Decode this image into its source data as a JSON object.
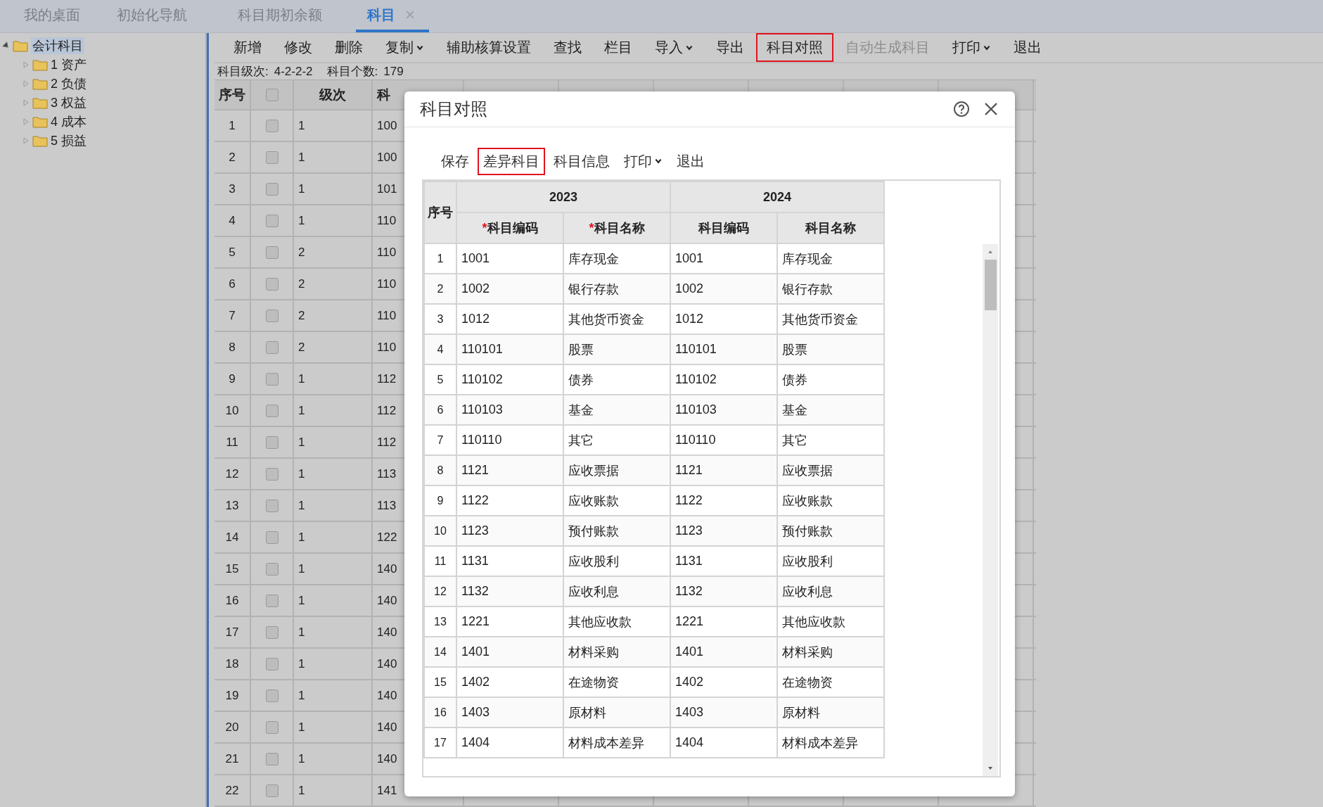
{
  "tabs": [
    {
      "label": "我的桌面",
      "selected": false
    },
    {
      "label": "初始化导航",
      "selected": false
    },
    {
      "label": "科目期初余额",
      "selected": false
    },
    {
      "label": "科目",
      "selected": true,
      "close": "×"
    }
  ],
  "tree": {
    "label": "会计科目",
    "expanded": true,
    "selected": true,
    "children": [
      {
        "label": "1 资产",
        "expanded": false
      },
      {
        "label": "2 负债",
        "expanded": false
      },
      {
        "label": "3 权益",
        "expanded": false
      },
      {
        "label": "4 成本",
        "expanded": false
      },
      {
        "label": "5 损益",
        "expanded": false
      }
    ]
  },
  "toolbar": [
    {
      "label": "新增",
      "dropdown": false,
      "disabled": false,
      "highlighted": false
    },
    {
      "label": "修改",
      "dropdown": false,
      "disabled": false,
      "highlighted": false
    },
    {
      "label": "删除",
      "dropdown": false,
      "disabled": false,
      "highlighted": false
    },
    {
      "label": "复制",
      "dropdown": true,
      "disabled": false,
      "highlighted": false
    },
    {
      "label": "辅助核算设置",
      "dropdown": false,
      "disabled": false,
      "highlighted": false
    },
    {
      "label": "查找",
      "dropdown": false,
      "disabled": false,
      "highlighted": false
    },
    {
      "label": "栏目",
      "dropdown": false,
      "disabled": false,
      "highlighted": false
    },
    {
      "label": "导入",
      "dropdown": true,
      "disabled": false,
      "highlighted": false
    },
    {
      "label": "导出",
      "dropdown": false,
      "disabled": false,
      "highlighted": false
    },
    {
      "label": "科目对照",
      "dropdown": false,
      "disabled": false,
      "highlighted": true
    },
    {
      "label": "自动生成科目",
      "dropdown": false,
      "disabled": true,
      "highlighted": false
    },
    {
      "label": "打印",
      "dropdown": true,
      "disabled": false,
      "highlighted": false
    },
    {
      "label": "退出",
      "dropdown": false,
      "disabled": false,
      "highlighted": false
    }
  ],
  "info": [
    {
      "label": "科目级次:",
      "value": "4-2-2-2"
    },
    {
      "label": "科目个数:",
      "value": "179"
    }
  ],
  "grid": {
    "columns": [
      "序号",
      "级次",
      "科"
    ],
    "header_checked": false,
    "rows": [
      {
        "no": "1",
        "checked": false,
        "level": "1",
        "code": "100"
      },
      {
        "no": "2",
        "checked": false,
        "level": "1",
        "code": "100"
      },
      {
        "no": "3",
        "checked": false,
        "level": "1",
        "code": "101"
      },
      {
        "no": "4",
        "checked": false,
        "level": "1",
        "code": "110"
      },
      {
        "no": "5",
        "checked": false,
        "level": "2",
        "code": "110"
      },
      {
        "no": "6",
        "checked": false,
        "level": "2",
        "code": "110"
      },
      {
        "no": "7",
        "checked": false,
        "level": "2",
        "code": "110"
      },
      {
        "no": "8",
        "checked": false,
        "level": "2",
        "code": "110"
      },
      {
        "no": "9",
        "checked": false,
        "level": "1",
        "code": "112"
      },
      {
        "no": "10",
        "checked": false,
        "level": "1",
        "code": "112"
      },
      {
        "no": "11",
        "checked": false,
        "level": "1",
        "code": "112"
      },
      {
        "no": "12",
        "checked": false,
        "level": "1",
        "code": "113"
      },
      {
        "no": "13",
        "checked": false,
        "level": "1",
        "code": "113"
      },
      {
        "no": "14",
        "checked": false,
        "level": "1",
        "code": "122"
      },
      {
        "no": "15",
        "checked": false,
        "level": "1",
        "code": "140"
      },
      {
        "no": "16",
        "checked": false,
        "level": "1",
        "code": "140"
      },
      {
        "no": "17",
        "checked": false,
        "level": "1",
        "code": "140"
      },
      {
        "no": "18",
        "checked": false,
        "level": "1",
        "code": "140"
      },
      {
        "no": "19",
        "checked": false,
        "level": "1",
        "code": "140"
      },
      {
        "no": "20",
        "checked": false,
        "level": "1",
        "code": "140"
      },
      {
        "no": "21",
        "checked": false,
        "level": "1",
        "code": "140"
      },
      {
        "no": "22",
        "checked": false,
        "level": "1",
        "code": "141"
      }
    ]
  },
  "dialog": {
    "title": "科目对照",
    "toolbar": [
      {
        "label": "保存",
        "dropdown": false,
        "highlighted": false
      },
      {
        "label": "差异科目",
        "dropdown": false,
        "highlighted": true
      },
      {
        "label": "科目信息",
        "dropdown": false,
        "highlighted": false
      },
      {
        "label": "打印",
        "dropdown": true,
        "highlighted": false
      },
      {
        "label": "退出",
        "dropdown": false,
        "highlighted": false
      }
    ],
    "table": {
      "groups": [
        "2023",
        "2024"
      ],
      "columns": [
        {
          "label": "序号"
        },
        {
          "label": "科目编码",
          "mark": "*"
        },
        {
          "label": "科目名称",
          "mark": "*"
        },
        {
          "label": "科目编码"
        },
        {
          "label": "科目名称"
        }
      ],
      "rows": [
        [
          "1",
          "1001",
          "库存现金",
          "1001",
          "库存现金"
        ],
        [
          "2",
          "1002",
          "银行存款",
          "1002",
          "银行存款"
        ],
        [
          "3",
          "1012",
          "其他货币资金",
          "1012",
          "其他货币资金"
        ],
        [
          "4",
          "110101",
          "股票",
          "110101",
          "股票"
        ],
        [
          "5",
          "110102",
          "债券",
          "110102",
          "债券"
        ],
        [
          "6",
          "110103",
          "基金",
          "110103",
          "基金"
        ],
        [
          "7",
          "110110",
          "其它",
          "110110",
          "其它"
        ],
        [
          "8",
          "1121",
          "应收票据",
          "1121",
          "应收票据"
        ],
        [
          "9",
          "1122",
          "应收账款",
          "1122",
          "应收账款"
        ],
        [
          "10",
          "1123",
          "预付账款",
          "1123",
          "预付账款"
        ],
        [
          "11",
          "1131",
          "应收股利",
          "1131",
          "应收股利"
        ],
        [
          "12",
          "1132",
          "应收利息",
          "1132",
          "应收利息"
        ],
        [
          "13",
          "1221",
          "其他应收款",
          "1221",
          "其他应收款"
        ],
        [
          "14",
          "1401",
          "材料采购",
          "1401",
          "材料采购"
        ],
        [
          "15",
          "1402",
          "在途物资",
          "1402",
          "在途物资"
        ],
        [
          "16",
          "1403",
          "原材料",
          "1403",
          "原材料"
        ],
        [
          "17",
          "1404",
          "材料成本差异",
          "1404",
          "材料成本差异"
        ]
      ]
    }
  }
}
